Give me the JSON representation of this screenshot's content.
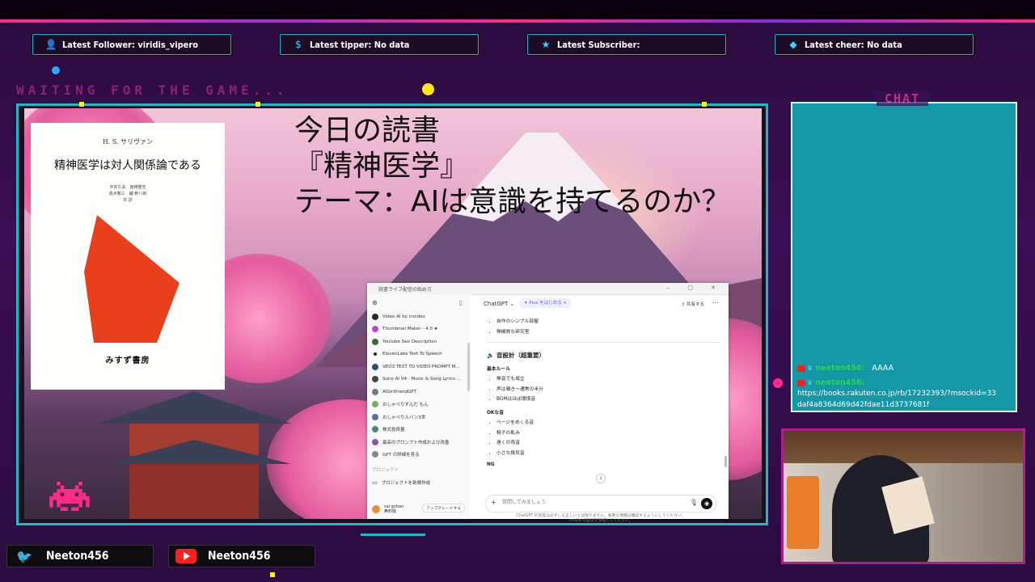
{
  "alerts": [
    {
      "icon": "user-icon",
      "label": "Latest Follower: viridis_vipero"
    },
    {
      "icon": "dollar-icon",
      "label": "Latest tipper: No data"
    },
    {
      "icon": "star-icon",
      "label": "Latest Subscriber:"
    },
    {
      "icon": "diamond-icon",
      "label": "Latest cheer: No data"
    }
  ],
  "status": {
    "waiting": "WAITING FOR THE GAME..."
  },
  "book": {
    "author": "H. S. サリヴァン",
    "title": "精神医学は対人関係論である",
    "translators": "中井久夫　宮崎隆吉\n高木敬三　鑪 幹八郎\n共 訳",
    "publisher": "みすず書房"
  },
  "overlay": {
    "line1": "今日の読書",
    "line2": "『精神医学』",
    "line3": "テーマ：AIは意識を持てるのか？"
  },
  "chatgpt": {
    "window_title": "読書ライブ配信の始め方",
    "model": "ChatGPT",
    "plus_badge": "✦ Plus をはじめる ×",
    "share": "共有する",
    "sidebar_items": [
      "Video AI by invideo",
      "Thumbnail Maker - 4.0 ★",
      "Youtube Seo Description",
      "ElevenLabs Text To Speech",
      "VEO3 TEXT TO VIDEO PROMPT M...",
      "Suno AI V4 - Music & Song Lyrics ...",
      "AIGirlfriendGPT",
      "おしゃべりずんだ もん",
      "おしゃべりルバン3世",
      "株式投資量",
      "最高のプロンプト作成および改善",
      "GPT の詳細を見る"
    ],
    "projects_heading": "プロジェクト",
    "new_project": "プロジェクトを新規作成",
    "user_name": "sai gohan",
    "user_plan": "無料版",
    "upgrade": "アップグレードする",
    "content": {
      "top_items": [
        "自作のシンプル部屋",
        "無機質な研究室"
      ],
      "heading": "🔉 音設計（超重要）",
      "rules_title": "基本ルール",
      "rules": [
        "無音でも成立",
        "声は囁き〜通常の半分",
        "BGMはほぼ環境音"
      ],
      "ok_title": "OKな音",
      "ok": [
        "ページをめくる音",
        "椅子の軋み",
        "遠くの雨音",
        "小さな換気音"
      ],
      "ng_title": "NG"
    },
    "composer_placeholder": "質問してみましょう",
    "disclaimer_1": "ChatGPT の回答は必ずしも正しいとは限りません。重要な情報は確認するようにしてください。",
    "disclaimer_2": "cookie の設定を参照してください。"
  },
  "chat": {
    "title": "CHAT",
    "messages": [
      {
        "user": "neeton456:",
        "text": "AAAA"
      },
      {
        "user": "neeton456:",
        "text": "https://books.rakuten.co.jp/rb/17232393/?msockid=33daf4a8364d69d42fdae11d3737681f"
      }
    ]
  },
  "social": {
    "twitter": "Neeton456",
    "youtube": "Neeton456"
  }
}
